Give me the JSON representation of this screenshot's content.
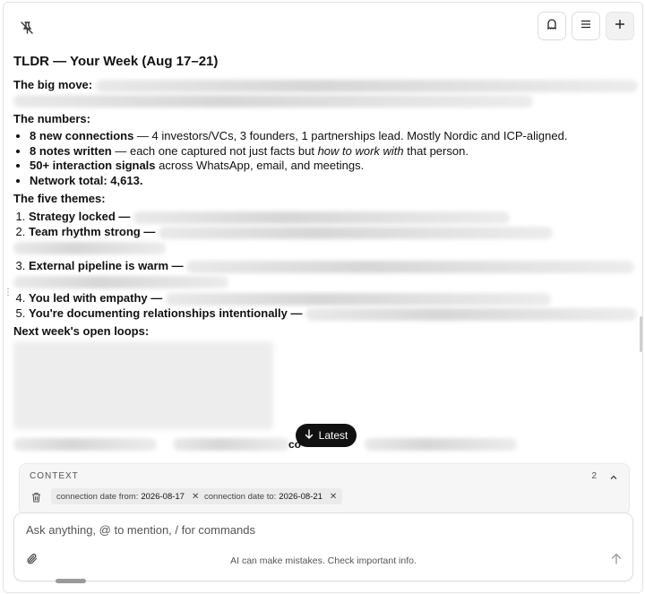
{
  "toolbar": {
    "left_icon": "pin-off-icon",
    "buttons": [
      "ghost-icon",
      "menu-icon",
      "plus-icon"
    ]
  },
  "summary": {
    "title": "TLDR — Your Week (Aug 17–21)",
    "big_move_label": "The big move:",
    "numbers_heading": "The numbers:",
    "numbers": [
      {
        "bold": "8 new connections",
        "rest": " — 4 investors/VCs, 3 founders, 1 partnerships lead. Mostly Nordic and ICP-aligned."
      },
      {
        "bold": "8 notes written",
        "rest_before": " — each one captured not just facts but ",
        "italic": "how to work with",
        "rest_after": " that person."
      },
      {
        "bold": "50+ interaction signals",
        "rest": " across WhatsApp, email, and meetings."
      },
      {
        "bold": "Network total: 4,613.",
        "rest": ""
      }
    ],
    "themes_heading": "The five themes:",
    "themes": [
      "Strategy locked —",
      "Team rhythm strong —",
      "External pipeline is warm —",
      "You led with empathy —",
      "You're documenting relationships intentionally —"
    ],
    "open_loops_heading": "Next week's open loops:",
    "partial_text": "co"
  },
  "latest_button": {
    "label": "Latest",
    "icon": "arrow-down-icon"
  },
  "context": {
    "label": "CONTEXT",
    "count": "2",
    "chips": [
      {
        "key": "connection date from:",
        "value": "2026-08-17"
      },
      {
        "key": "connection date to:",
        "value": "2026-08-21"
      }
    ]
  },
  "composer": {
    "placeholder": "Ask anything, @ to mention, / for commands",
    "disclaimer": "AI can make mistakes. Check important info."
  }
}
